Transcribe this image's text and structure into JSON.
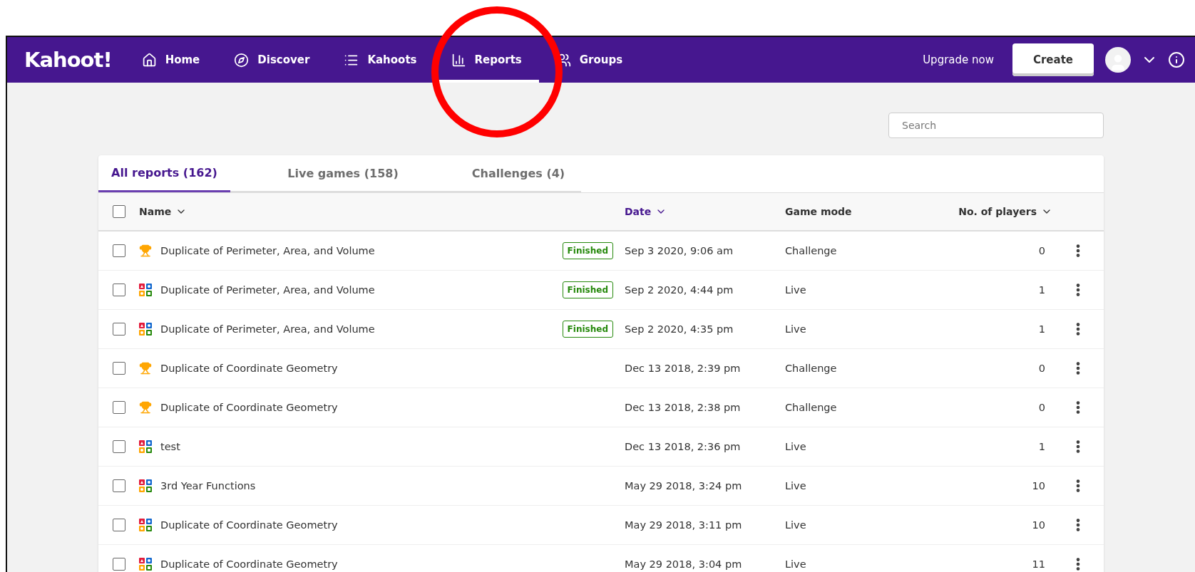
{
  "nav": {
    "logo": "Kahoot!",
    "items": [
      {
        "label": "Home",
        "kind": "home",
        "selected": false
      },
      {
        "label": "Discover",
        "kind": "discover",
        "selected": false
      },
      {
        "label": "Kahoots",
        "kind": "kahoots",
        "selected": false
      },
      {
        "label": "Reports",
        "kind": "reports",
        "selected": true
      },
      {
        "label": "Groups",
        "kind": "groups",
        "selected": false
      }
    ],
    "upgrade": "Upgrade now",
    "create": "Create"
  },
  "search": {
    "placeholder": "Search"
  },
  "tabs": [
    {
      "label": "All reports (162)",
      "selected": true
    },
    {
      "label": "Live games (158)",
      "selected": false
    },
    {
      "label": "Challenges (4)",
      "selected": false
    }
  ],
  "table": {
    "select_all_checked": false,
    "columns": [
      {
        "label": "Name",
        "sortable": true,
        "sorted": false
      },
      {
        "label": "Date",
        "sortable": true,
        "sorted": true
      },
      {
        "label": "Game mode",
        "sortable": false,
        "sorted": false
      },
      {
        "label": "No. of players",
        "sortable": true,
        "sorted": false
      }
    ],
    "rows": [
      {
        "checked": false,
        "kind": "challenge",
        "name": "Duplicate of Perimeter, Area, and Volume",
        "status": "Finished",
        "date": "Sep 3 2020, 9:06 am",
        "mode": "Challenge",
        "players": "0"
      },
      {
        "checked": false,
        "kind": "live",
        "name": "Duplicate of Perimeter, Area, and Volume",
        "status": "Finished",
        "date": "Sep 2 2020, 4:44 pm",
        "mode": "Live",
        "players": "1"
      },
      {
        "checked": false,
        "kind": "live",
        "name": "Duplicate of Perimeter, Area, and Volume",
        "status": "Finished",
        "date": "Sep 2 2020, 4:35 pm",
        "mode": "Live",
        "players": "1"
      },
      {
        "checked": false,
        "kind": "challenge",
        "name": "Duplicate of Coordinate Geometry",
        "date": "Dec 13 2018, 2:39 pm",
        "mode": "Challenge",
        "players": "0"
      },
      {
        "checked": false,
        "kind": "challenge",
        "name": "Duplicate of Coordinate Geometry",
        "date": "Dec 13 2018, 2:38 pm",
        "mode": "Challenge",
        "players": "0"
      },
      {
        "checked": false,
        "kind": "live",
        "name": "test",
        "date": "Dec 13 2018, 2:36 pm",
        "mode": "Live",
        "players": "1"
      },
      {
        "checked": false,
        "kind": "live",
        "name": "3rd Year Functions",
        "date": "May 29 2018, 3:24 pm",
        "mode": "Live",
        "players": "10"
      },
      {
        "checked": false,
        "kind": "live",
        "name": "Duplicate of Coordinate Geometry",
        "date": "May 29 2018, 3:11 pm",
        "mode": "Live",
        "players": "10"
      },
      {
        "checked": false,
        "kind": "live",
        "name": "Duplicate of Coordinate Geometry",
        "date": "May 29 2018, 3:04 pm",
        "mode": "Live",
        "players": "11"
      }
    ]
  },
  "annotation": {
    "kind": "circle"
  }
}
